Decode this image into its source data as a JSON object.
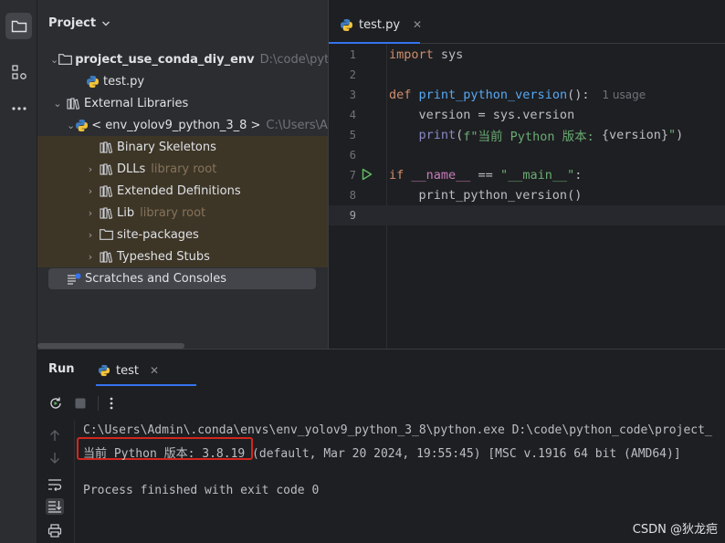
{
  "activity_bar": {
    "items": [
      "folder-icon",
      "structure-icon",
      "more-icon"
    ]
  },
  "project": {
    "header": "Project",
    "tree": [
      {
        "label": "project_use_conda_diy_env",
        "hint": "D:\\code\\python_",
        "bold": true
      },
      {
        "label": "test.py"
      },
      {
        "label": "External Libraries"
      },
      {
        "label": "< env_yolov9_python_3_8 >",
        "hint": "C:\\Users\\Adm"
      },
      {
        "label": "Binary Skeletons"
      },
      {
        "label": "DLLs",
        "hint": "library root"
      },
      {
        "label": "Extended Definitions"
      },
      {
        "label": "Lib",
        "hint": "library root"
      },
      {
        "label": "site-packages"
      },
      {
        "label": "Typeshed Stubs"
      }
    ],
    "scratches": "Scratches and Consoles"
  },
  "editor": {
    "tab": "test.py",
    "line_numbers": [
      "1",
      "2",
      "3",
      "4",
      "5",
      "6",
      "7",
      "8",
      "9"
    ],
    "code": {
      "l1_kw": "import",
      "l1_rest": " sys",
      "l3_kw": "def",
      "l3_fn": " print_python_version",
      "l3_rest": "():",
      "l3_inlay": "1 usage",
      "l4": "    version = sys.version",
      "l5_fn": "    print",
      "l5_p": "(",
      "l5_str1": "f\"当前 Python 版本: ",
      "l5_brace": "{version}",
      "l5_str2": "\"",
      "l5_close": ")",
      "l7_kw": "if",
      "l7_mag": " __name__",
      "l7_eq": " == ",
      "l7_str": "\"__main__\"",
      "l7_colon": ":",
      "l8": "    print_python_version()"
    }
  },
  "run": {
    "title": "Run",
    "tab": "test",
    "console": {
      "cmd": "C:\\Users\\Admin\\.conda\\envs\\env_yolov9_python_3_8\\python.exe D:\\code\\python_code\\project_",
      "version_prefix": "当前 Python 版本: 3.8.19",
      "version_rest": " (default, Mar 20 2024, 19:55:45) [MSC v.1916 64 bit (AMD64)]",
      "exit": "Process finished with exit code 0"
    }
  },
  "watermark": "CSDN @狄龙疤"
}
